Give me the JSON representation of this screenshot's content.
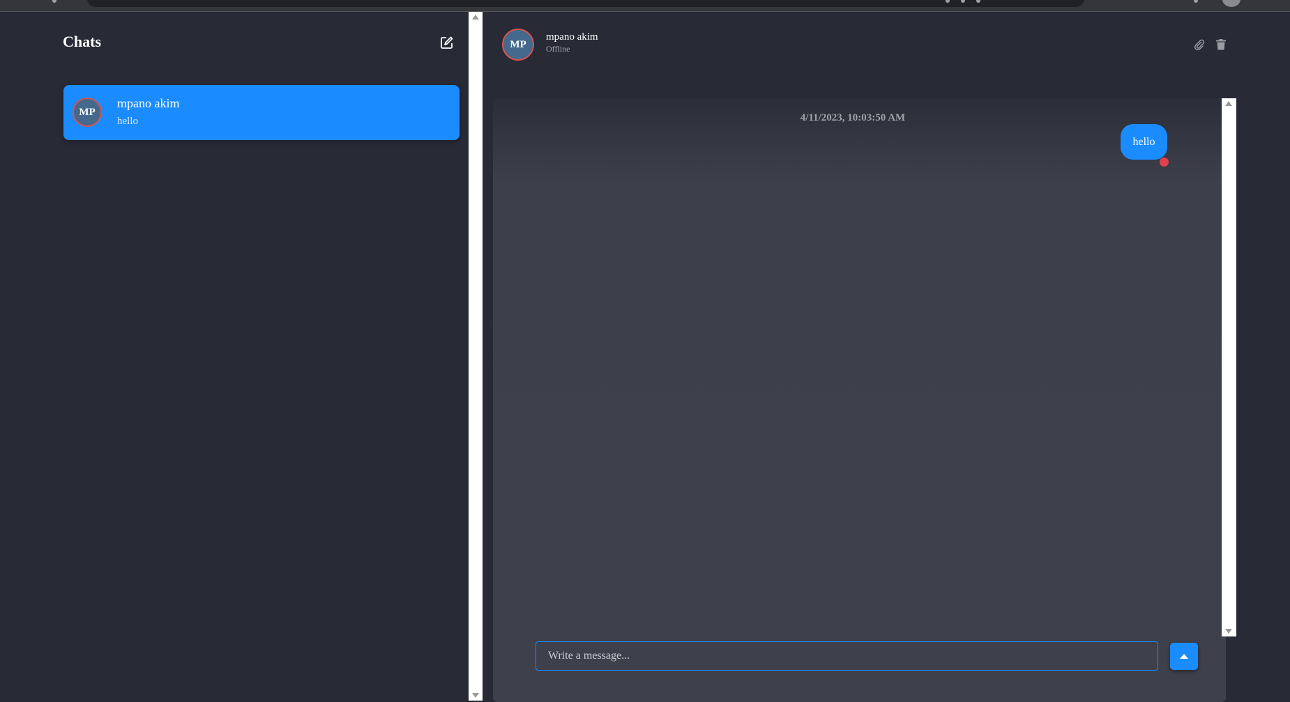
{
  "sidebar": {
    "title": "Chats",
    "compose_icon": "edit-icon",
    "chats": [
      {
        "initials": "MP",
        "name": "mpano akim",
        "preview": "hello",
        "selected": true
      }
    ]
  },
  "conversation": {
    "contact": {
      "initials": "MP",
      "name": "mpano akim",
      "status": "Offline"
    },
    "header_icons": [
      "paperclip-icon",
      "trash-icon"
    ],
    "messages": [
      {
        "timestamp": "4/11/2023, 10:03:50 AM",
        "text": "hello",
        "outgoing": true
      }
    ],
    "composer": {
      "placeholder": "Write a message...",
      "value": ""
    },
    "send_icon": "caret-up-icon"
  },
  "colors": {
    "background": "#282a36",
    "accent": "#1a8cff",
    "avatar_bg": "#45698c",
    "unread_dot": "#e0424d"
  }
}
